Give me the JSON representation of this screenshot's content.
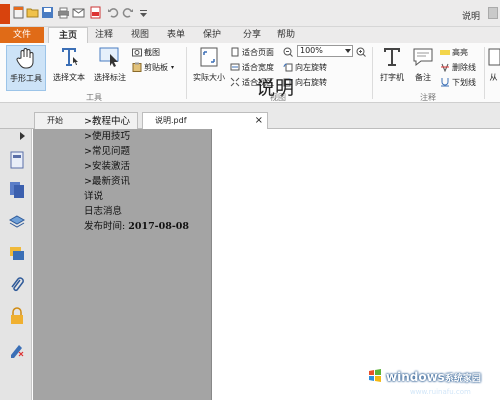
{
  "title_bar": {
    "title": "说明"
  },
  "menu": {
    "file": "文件",
    "tabs": [
      "主页",
      "注释",
      "视图",
      "表单",
      "保护",
      "分享",
      "帮助"
    ]
  },
  "ribbon": {
    "hand_tool": "手形工具",
    "select_text": "选择文本",
    "select_annotation": "选择标注",
    "screenshot": "截图",
    "clipboard": "剪贴板",
    "tools_group": "工具",
    "actual_size": "实际大小",
    "fit_page": "适合页面",
    "fit_width": "适合宽度",
    "fit_view": "适合视区",
    "zoom_value": "100%",
    "rotate_left": "向左旋转",
    "rotate_right": "向右旋转",
    "view_group": "视图",
    "typewriter": "打字机",
    "note": "备注",
    "highlight": "高亮",
    "strikethrough": "删除线",
    "underline": "下划线",
    "annotation_group": "注释",
    "extra": "从"
  },
  "doc_tabs": {
    "start": "开始",
    "file": "说明.pdf"
  },
  "document": {
    "title": "说明",
    "items": [
      ">教程中心",
      ">使用技巧",
      ">常见问题",
      ">安装激活",
      ">最新资讯",
      "详说",
      "日志消息"
    ],
    "publish_label": "发布时间:",
    "publish_date": "2017-08-08"
  },
  "watermark": {
    "brand": "windows",
    "brand_cn": "系统家园",
    "url": "www.ruinafu.com"
  },
  "colors": {
    "file_menu": "#e06b17",
    "workspace": "#a4a4a4",
    "selected": "#cde3f7"
  }
}
